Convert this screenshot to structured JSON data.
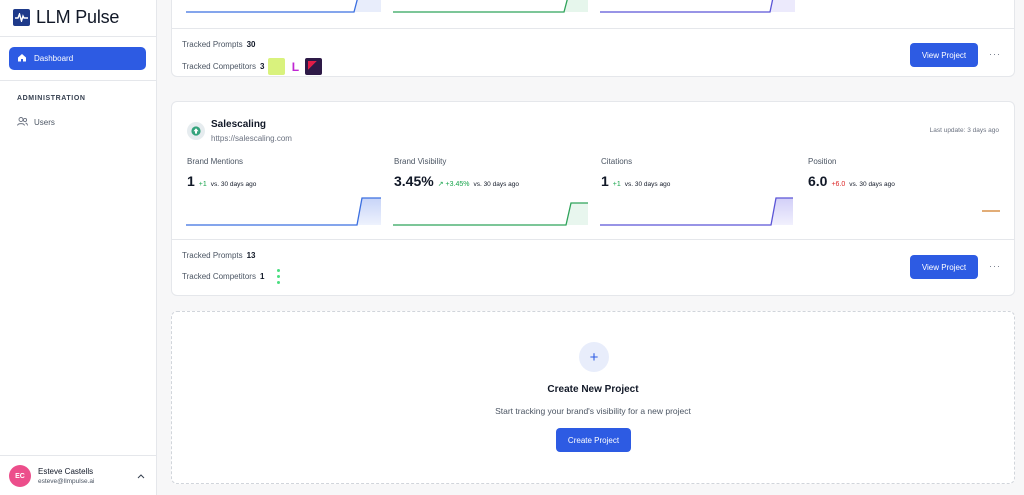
{
  "app": {
    "name": "LLM Pulse",
    "brand_color": "#1e3a8a",
    "accent": "#2d5be3"
  },
  "sidebar": {
    "active_item": {
      "label": "Dashboard",
      "icon": "home-icon"
    },
    "section_title": "ADMINISTRATION",
    "items": [
      {
        "label": "Users",
        "icon": "users-icon"
      }
    ],
    "user": {
      "initials": "EC",
      "name": "Esteve Castells",
      "email": "esteve@llmpulse.ai"
    }
  },
  "project1": {
    "tracked_prompts_label": "Tracked Prompts",
    "tracked_prompts": "30",
    "tracked_competitors_label": "Tracked Competitors",
    "tracked_competitors": "3",
    "competitor_L": "L",
    "view_button": "View Project",
    "more": "···"
  },
  "project2": {
    "name": "Salescaling",
    "url": "https://salescaling.com",
    "last_update": "Last update: 3 days ago",
    "metrics": [
      {
        "label": "Brand Mentions",
        "value": "1",
        "change": "+1",
        "change_color": "#16a34a",
        "vs": "vs. 30 days ago"
      },
      {
        "label": "Brand Visibility",
        "value": "3.45%",
        "change": "↗ +3.45%",
        "change_color": "#16a34a",
        "vs": "vs. 30 days ago"
      },
      {
        "label": "Citations",
        "value": "1",
        "change": "+1",
        "change_color": "#16a34a",
        "vs": "vs. 30 days ago"
      },
      {
        "label": "Position",
        "value": "6.0",
        "change": "+6.0",
        "change_color": "#dc2626",
        "vs": "vs. 30 days ago"
      }
    ],
    "tracked_prompts_label": "Tracked Prompts",
    "tracked_prompts": "13",
    "tracked_competitors_label": "Tracked Competitors",
    "tracked_competitors": "1",
    "view_button": "View Project",
    "more": "···"
  },
  "create": {
    "plus": "+",
    "title": "Create New Project",
    "subtitle": "Start tracking your brand's visibility for a new project",
    "button": "Create Project"
  }
}
